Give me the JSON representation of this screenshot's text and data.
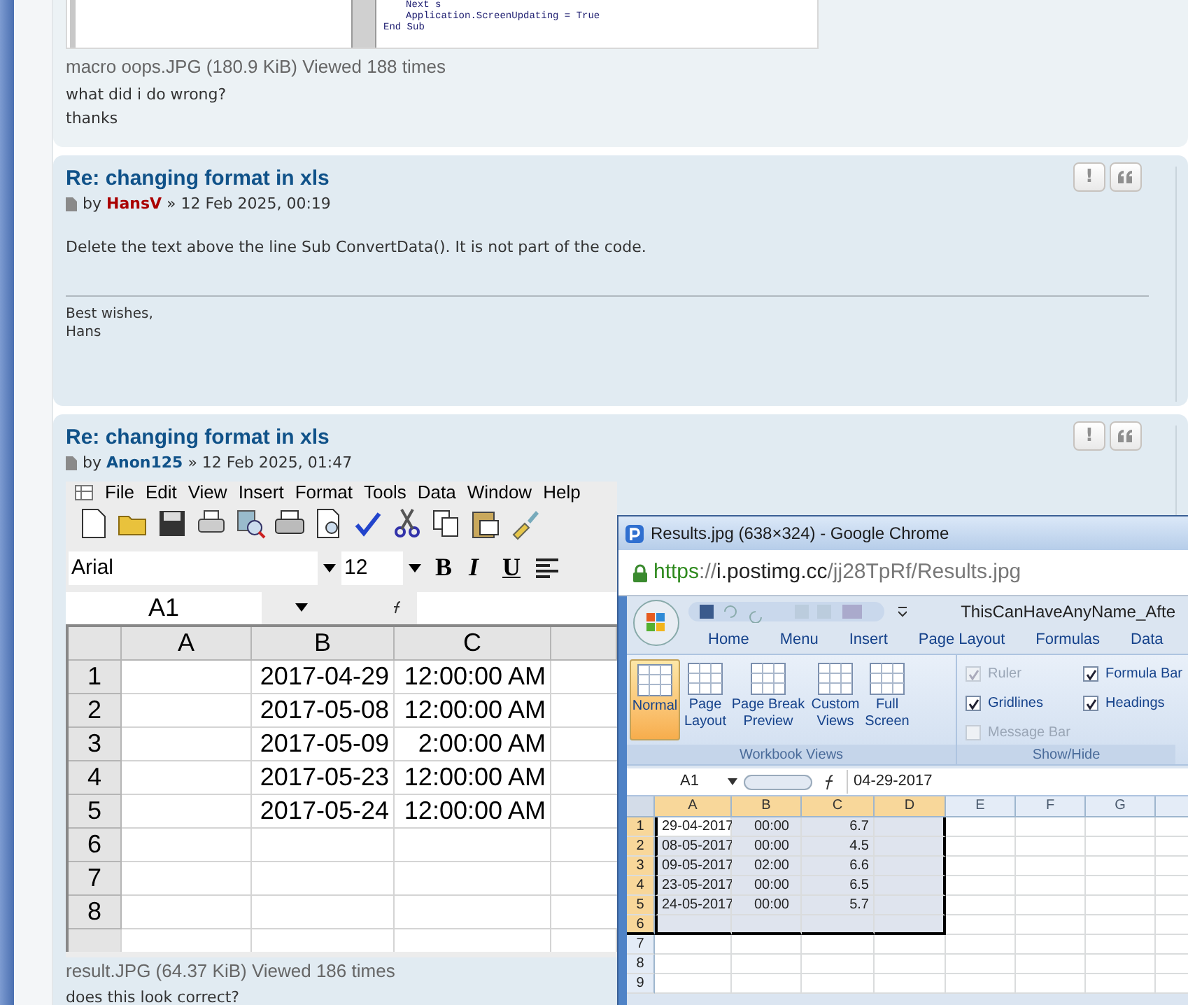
{
  "posts": [
    {
      "attachment": {
        "code_lines": [
          "Next s",
          "Application.ScreenUpdating = True",
          "End Sub"
        ],
        "caption": "macro oops.JPG (180.9 KiB) Viewed 188 times"
      },
      "body": [
        "what did i do wrong?",
        "thanks"
      ]
    },
    {
      "title": "Re: changing format in xls",
      "by_label": "by",
      "author": {
        "name": "HansV",
        "color": "#aa0000"
      },
      "separator": "»",
      "date": "12 Feb 2025, 00:19",
      "report_button": "!",
      "body": [
        "Delete the text above the line Sub ConvertData(). It is not part of the code."
      ],
      "signature": [
        "Best wishes,",
        "Hans"
      ]
    },
    {
      "title": "Re: changing format in xls",
      "by_label": "by",
      "author": {
        "name": "Anon125",
        "color": "#105289"
      },
      "separator": "»",
      "date": "12 Feb 2025, 01:47",
      "report_button": "!",
      "attachment": {
        "sheet": {
          "menu": [
            "File",
            "Edit",
            "View",
            "Insert",
            "Format",
            "Tools",
            "Data",
            "Window",
            "Help"
          ],
          "font": "Arial",
          "font_size": "12",
          "format_buttons": [
            "B",
            "I",
            "U"
          ],
          "name_box": "A1",
          "columns": [
            "A",
            "B",
            "C"
          ],
          "rows": [
            {
              "header": "1",
              "date": "2017-04-29",
              "time": "12:00:00 AM"
            },
            {
              "header": "2",
              "date": "2017-05-08",
              "time": "12:00:00 AM"
            },
            {
              "header": "3",
              "date": "2017-05-09",
              "time": "2:00:00 AM"
            },
            {
              "header": "4",
              "date": "2017-05-23",
              "time": "12:00:00 AM"
            },
            {
              "header": "5",
              "date": "2017-05-24",
              "time": "12:00:00 AM"
            },
            {
              "header": "6"
            },
            {
              "header": "7"
            },
            {
              "header": "8"
            }
          ]
        },
        "caption": "result.JPG (64.37 KiB) Viewed 186 times"
      },
      "body": [
        "does this look correct?"
      ]
    }
  ],
  "popup_window": {
    "title": "Results.jpg (638×324) - Google Chrome",
    "url": {
      "scheme": "https",
      "separator": "://",
      "host": "i.postimg.cc",
      "path": "/jj28TpRf/Results.jpg"
    },
    "excel": {
      "title": "ThisCanHaveAnyName_Afte",
      "tabs": [
        "Home",
        "Menu",
        "Insert",
        "Page Layout",
        "Formulas",
        "Data"
      ],
      "view_buttons": [
        {
          "label": "Normal",
          "selected": true
        },
        {
          "label": "Page Layout",
          "selected": false
        },
        {
          "label": "Page Break Preview",
          "selected": false
        },
        {
          "label": "Custom Views",
          "selected": false
        },
        {
          "label": "Full Screen",
          "selected": false
        }
      ],
      "view_group": "Workbook Views",
      "options": [
        {
          "label": "Ruler",
          "checked": true,
          "disabled": true
        },
        {
          "label": "Gridlines",
          "checked": true,
          "disabled": false
        },
        {
          "label": "Message Bar",
          "checked": false,
          "disabled": true
        },
        {
          "label": "Formula Bar",
          "checked": true,
          "disabled": false
        },
        {
          "label": "Headings",
          "checked": true,
          "disabled": false
        }
      ],
      "options_group": "Show/Hide",
      "name_box": "A1",
      "formula": "04-29-2017",
      "columns": [
        {
          "label": "A",
          "selected": true
        },
        {
          "label": "B",
          "selected": true
        },
        {
          "label": "C",
          "selected": true
        },
        {
          "label": "D",
          "selected": true
        },
        {
          "label": "E",
          "selected": false
        },
        {
          "label": "F",
          "selected": false
        },
        {
          "label": "G",
          "selected": false
        }
      ],
      "rows": [
        {
          "header": "1",
          "selected": true,
          "date": "29-04-2017",
          "time": "00:00",
          "value": "6.7"
        },
        {
          "header": "2",
          "selected": true,
          "date": "08-05-2017",
          "time": "00:00",
          "value": "4.5"
        },
        {
          "header": "3",
          "selected": true,
          "date": "09-05-2017",
          "time": "02:00",
          "value": "6.6"
        },
        {
          "header": "4",
          "selected": true,
          "date": "23-05-2017",
          "time": "00:00",
          "value": "6.5"
        },
        {
          "header": "5",
          "selected": true,
          "date": "24-05-2017",
          "time": "00:00",
          "value": "5.7"
        },
        {
          "header": "6",
          "selected": true
        },
        {
          "header": "7",
          "selected": false
        },
        {
          "header": "8",
          "selected": false
        },
        {
          "header": "9",
          "selected": false
        }
      ]
    }
  }
}
